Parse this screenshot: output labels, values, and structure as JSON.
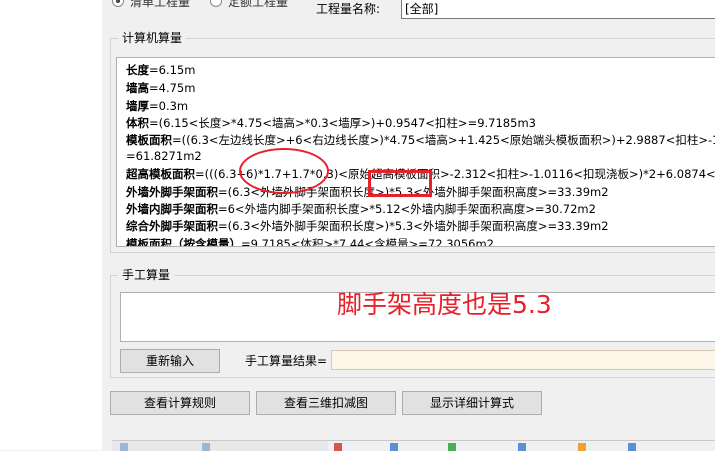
{
  "top": {
    "radio_list": "清单工程量",
    "radio_quota": "定额工程量",
    "quantity_name_label": "工程量名称:",
    "quantity_name_value": "[全部]"
  },
  "computer_section": {
    "title": "计算机算量",
    "lines": [
      {
        "bold": "长度",
        "rest": "=6.15m"
      },
      {
        "bold": "墙高",
        "rest": "=4.75m"
      },
      {
        "bold": "墙厚",
        "rest": "=0.3m"
      },
      {
        "bold": "体积",
        "rest": "=(6.15<长度>*4.75<墙高>*0.3<墙厚>)+0.9547<扣柱>=9.7185m3"
      },
      {
        "bold": "模板面积",
        "rest": "=((6.3<左边线长度>+6<右边线长度>)*4.75<墙高>+1.425<原始端头模板面积>)+2.9887<扣柱>-1.2"
      },
      {
        "bold": "",
        "rest": "=61.8271m2"
      },
      {
        "bold": "超高模板面积",
        "rest": "=(((6.3+6)*1.7+1.7*0.3)<原始超高模板面积>-2.312<扣柱>-1.0116<扣现浇板>)*2+6.0874<加"
      },
      {
        "bold": "外墙外脚手架面积",
        "rest": "=(6.3<外墙外脚手架面积长度>)*5.3<外墙外脚手架面积高度>=33.39m2"
      },
      {
        "bold": "外墙内脚手架面积",
        "rest": "=6<外墙内脚手架面积长度>*5.12<外墙内脚手架面积高度>=30.72m2"
      },
      {
        "bold": "综合外脚手架面积",
        "rest": "=(6.3<外墙外脚手架面积长度>)*5.3<外墙外脚手架面积高度>=33.39m2"
      },
      {
        "bold": "模板面积（按含模量）",
        "rest": "=9.7185<体积>*7.44<含模量>=72.3056m2"
      }
    ]
  },
  "manual_section": {
    "title": "手工算量",
    "reinput_button": "重新输入",
    "result_label": "手工算量结果="
  },
  "buttons": {
    "view_rules": "查看计算规则",
    "view_3d": "查看三维扣减图",
    "show_detail": "显示详细计算式"
  },
  "annotation": {
    "text": "脚手架高度也是5.3",
    "color": "#e8202a"
  }
}
